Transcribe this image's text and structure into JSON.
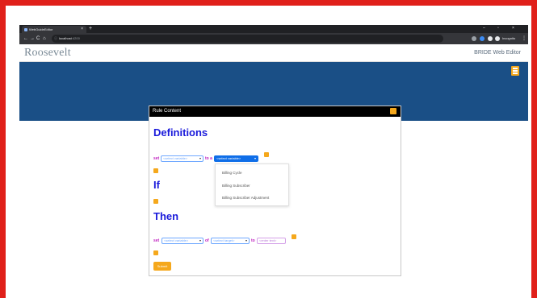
{
  "browser": {
    "tab_title": "WebGuideEditor",
    "tab_close": "×",
    "new_tab": "+",
    "url_host": "localhost",
    "url_port": ":4200",
    "incognito_label": "Incognito",
    "win_min": "–",
    "win_max": "▫",
    "win_close": "×",
    "back": "←",
    "forward": "→",
    "reload": "C",
    "home": "⌂",
    "menu": "⋮"
  },
  "app": {
    "logo": "Roosevelt",
    "title": "BRIDE Web Editor"
  },
  "modal": {
    "title": "Rule Content",
    "definitions_heading": "Definitions",
    "if_heading": "If",
    "then_heading": "Then",
    "def_row": {
      "set_kw": "set",
      "variable_select": "<select variable>",
      "to_a_kw": "to a",
      "variable_select_2": "<select variable>"
    },
    "dropdown_options": [
      "Billing Cycle",
      "Billing Subscriber",
      "Billing Subscriber Adjustment"
    ],
    "then_row": {
      "set_kw": "set",
      "variable_select": "<select variable>",
      "of_kw": "of",
      "target_select": "<select target>",
      "to_kw": "to",
      "text_input_placeholder": "<enter text>"
    },
    "submit_label": "Submit"
  },
  "colors": {
    "frame": "#e0201a",
    "banner": "#1a4f86",
    "accent": "#f5a81c",
    "heading": "#1a1adb",
    "keyword": "#c022c0",
    "select_border": "#6fa8ff"
  }
}
